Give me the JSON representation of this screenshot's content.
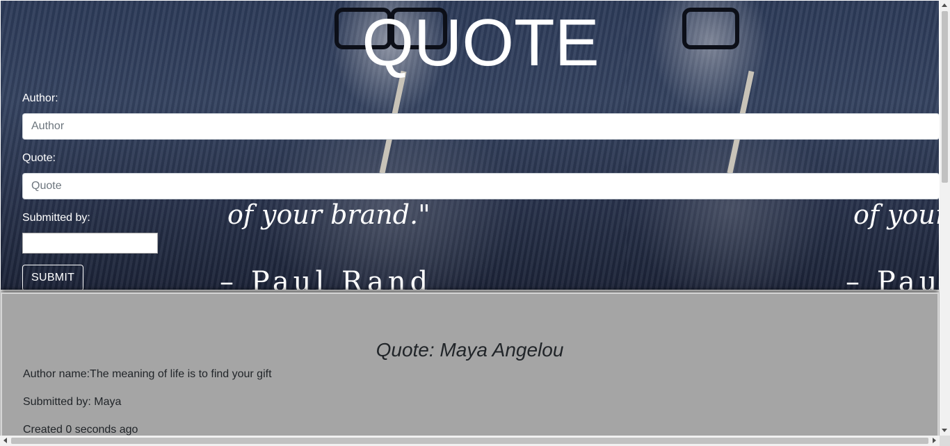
{
  "hero": {
    "title": "QUOTE",
    "image_quote_line": "of your brand.\"",
    "image_quote_line_cut": "of your",
    "image_author": "– Paul  Rand",
    "image_author_cut": "– Paul"
  },
  "form": {
    "author_label": "Author:",
    "author_placeholder": "Author",
    "author_value": "",
    "quote_label": "Quote:",
    "quote_placeholder": "Quote",
    "quote_value": "",
    "submitted_by_label": "Submitted by:",
    "submitted_by_value": "",
    "submit_label": "SUBMIT"
  },
  "quote_card": {
    "title": "Quote: Maya Angelou",
    "author_line": "Author name:The meaning of life is to find your gift",
    "submitted_line": "Submitted by: Maya",
    "created_line": "Created 0 seconds ago"
  },
  "colors": {
    "hero_overlay": "#2c3a58",
    "card_background": "#a5a5a5",
    "text_dark": "#212529"
  }
}
